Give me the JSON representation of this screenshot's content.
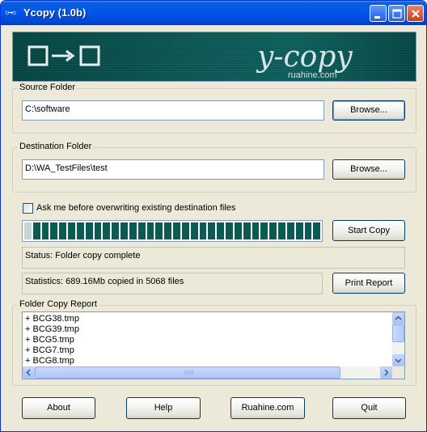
{
  "window": {
    "title": "Ycopy (1.0b)",
    "icon": "arrow-copy-icon",
    "title_icon_glyph": "▫→▫"
  },
  "banner": {
    "logo_text": "y-copy",
    "site_text": "ruahine.com",
    "colors": {
      "background": "#0b5553",
      "logo": "#d9e6e4"
    }
  },
  "source": {
    "group_label": "Source Folder",
    "path": "C:\\software",
    "browse_label": "Browse..."
  },
  "destination": {
    "group_label": "Destination Folder",
    "path": "D:\\WA_TestFiles\\test",
    "browse_label": "Browse..."
  },
  "options": {
    "overwrite_label": "Ask me before overwriting existing destination files",
    "overwrite_checked": false
  },
  "progress": {
    "fraction": 1.0,
    "segments": 34,
    "color": "#0b5b55"
  },
  "actions": {
    "start_copy_label": "Start Copy",
    "print_report_label": "Print Report"
  },
  "status": {
    "text": "Status: Folder copy complete",
    "statistics": "Statistics: 689.16Mb copied in 5068 files"
  },
  "report": {
    "group_label": "Folder Copy Report",
    "items": [
      "+ BCG38.tmp",
      "+ BCG39.tmp",
      "+ BCG5.tmp",
      "+ BCG7.tmp",
      "+ BCG8.tmp"
    ]
  },
  "footer": {
    "about_label": "About",
    "help_label": "Help",
    "site_label": "Ruahine.com",
    "quit_label": "Quit"
  }
}
